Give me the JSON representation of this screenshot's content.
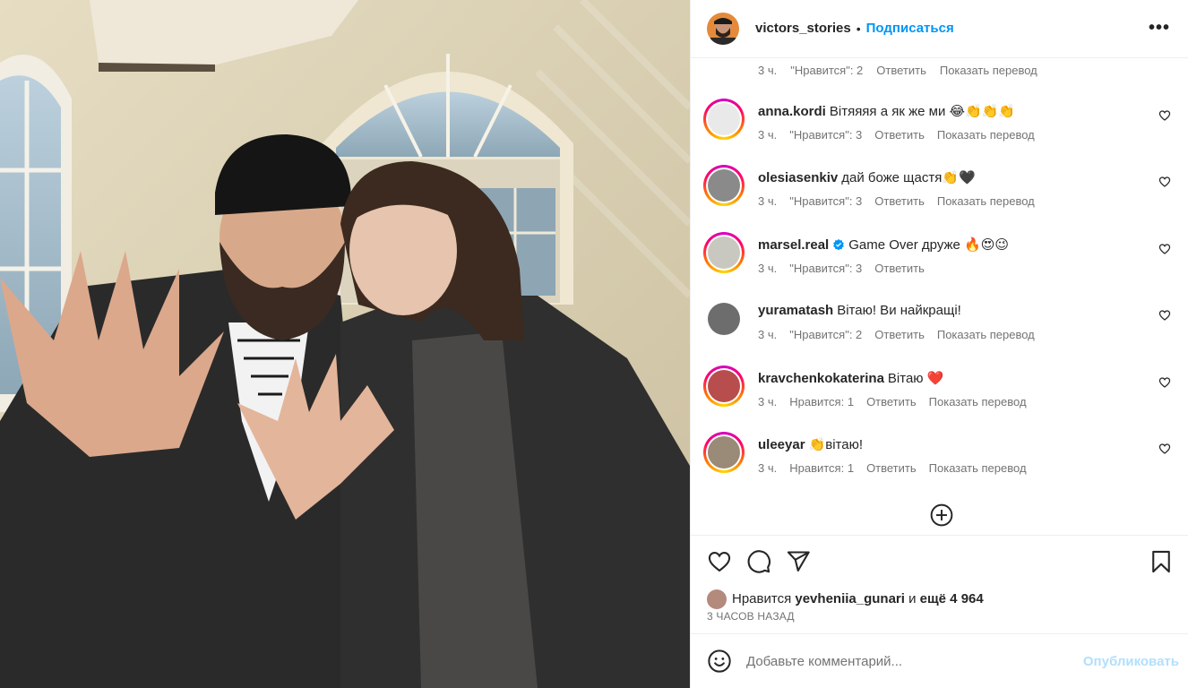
{
  "post": {
    "username": "victors_stories",
    "separator": "•",
    "follow_label": "Подписаться",
    "more_label": "•••"
  },
  "first_reply_meta": {
    "time": "3 ч.",
    "likes": "\"Нравится\": 2",
    "reply": "Ответить",
    "translate": "Показать перевод"
  },
  "comments": [
    {
      "user": "anna.kordi",
      "text": "Вітяяяя а як же ми 😂👏👏👏",
      "time": "3 ч.",
      "likes": "\"Нравится\": 3",
      "reply": "Ответить",
      "translate": "Показать перевод",
      "avatar_color": "#e9e9e9"
    },
    {
      "user": "olesiasenkiv",
      "text": "дай боже щастя👏🖤",
      "time": "3 ч.",
      "likes": "\"Нравится\": 3",
      "reply": "Ответить",
      "translate": "Показать перевод",
      "avatar_color": "#8a8a8a"
    },
    {
      "user": "marsel.real",
      "text": "Game Over друже 🔥😍😉",
      "time": "3 ч.",
      "likes": "\"Нравится\": 3",
      "reply": "Ответить",
      "translate": "",
      "avatar_color": "#c8c8c0"
    },
    {
      "user": "yuramatash",
      "text": "Вітаю! Ви найкращі!",
      "time": "3 ч.",
      "likes": "\"Нравится\": 2",
      "reply": "Ответить",
      "translate": "Показать перевод",
      "avatar_color": "#6d6d6d"
    },
    {
      "user": "kravchenkokaterina",
      "text": "Вітаю ❤️",
      "time": "3 ч.",
      "likes": "Нравится: 1",
      "reply": "Ответить",
      "translate": "Показать перевод",
      "avatar_color": "#b84d4d"
    },
    {
      "user": "uleeyar",
      "text": "👏вітаю!",
      "time": "3 ч.",
      "likes": "Нравится: 1",
      "reply": "Ответить",
      "translate": "Показать перевод",
      "avatar_color": "#9a8a78"
    }
  ],
  "likes_line": {
    "prefix": "Нравится",
    "user": "yevheniia_gunari",
    "middle": "и",
    "rest": "ещё 4 964"
  },
  "posted_ago": "3 ЧАСОВ НАЗАД",
  "composer": {
    "placeholder": "Добавьте комментарий...",
    "post_label": "Опубликовать"
  },
  "colors": {
    "accent": "#0095f6",
    "muted": "#737373",
    "post_disabled": "#b2dffc"
  }
}
